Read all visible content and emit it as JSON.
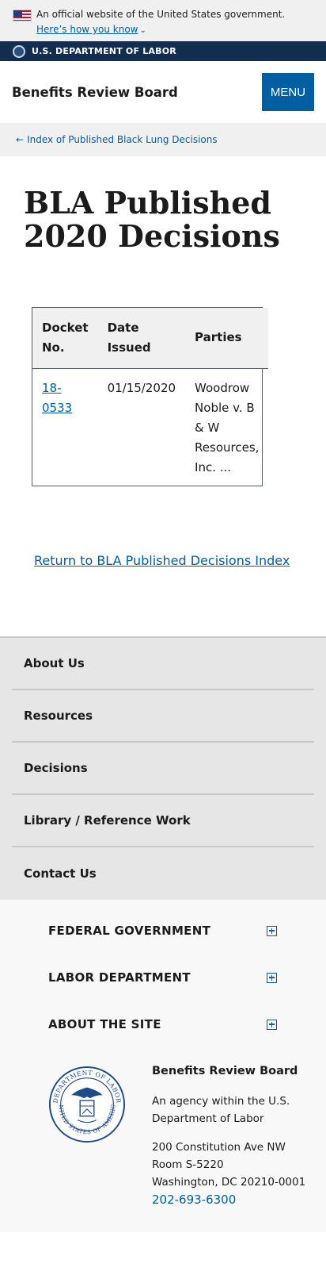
{
  "banner": {
    "text": "An official website of the United States government.",
    "link": "Here’s how you know",
    "flag_icon": "us-flag-icon"
  },
  "dol_bar": {
    "title": "U.S. DEPARTMENT OF LABOR"
  },
  "header": {
    "site_title": "Benefits Review Board",
    "menu_label": "MENU"
  },
  "breadcrumb": {
    "arrow": "←",
    "label": "Index of Published Black Lung Decisions"
  },
  "page": {
    "title": "BLA Published 2020 Decisions"
  },
  "table": {
    "headers": [
      "Docket No.",
      "Date Issued",
      "Parties"
    ],
    "rows": [
      {
        "docket": "18-0533",
        "date": "01/15/2020",
        "parties": "Woodrow Noble v. B & W Resources, Inc. ..."
      }
    ]
  },
  "return_link": "Return to BLA Published Decisions Index",
  "footer_nav": {
    "items": [
      "About Us",
      "Resources",
      "Decisions",
      "Library / Reference Work",
      "Contact Us"
    ]
  },
  "footer_sections": {
    "items": [
      "FEDERAL GOVERNMENT",
      "LABOR DEPARTMENT",
      "ABOUT THE SITE"
    ]
  },
  "agency": {
    "name": "Benefits Review Board",
    "description": "An agency within the U.S. Department of Labor",
    "address1": "200 Constitution Ave NW",
    "address2": "Room S-5220",
    "address3": "Washington, DC 20210-0001",
    "phone": "202-693-6300",
    "seal_text_top": "DEPARTMENT OF LABOR",
    "seal_text_bottom": "UNITED STATES OF AMERICA"
  },
  "colors": {
    "link": "#005ea2",
    "dol_bar": "#112e51",
    "menu_button": "#005ea2"
  }
}
